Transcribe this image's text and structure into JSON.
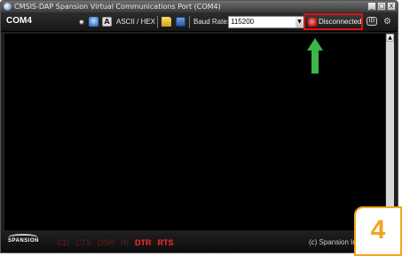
{
  "window": {
    "title": "CMSIS-DAP Spansion Virtual Communications Port (COM4)",
    "controls": {
      "minimize": "_",
      "maximize": "□",
      "close": "X"
    }
  },
  "toolbar": {
    "port": "COM4",
    "ascii_hex_label": "ASCII / HEX",
    "ascii_icon_label": "A",
    "baud_label": "Baud Rate:",
    "baud_value": "115200",
    "connection_status": "Disconnected",
    "id_icon_label": "ID"
  },
  "status_bar": {
    "logo": "SPANSION",
    "signals": [
      {
        "label": "CD",
        "active": false
      },
      {
        "label": "CTS",
        "active": false
      },
      {
        "label": "DSR",
        "active": false
      },
      {
        "label": "RI",
        "active": false
      },
      {
        "label": "DTR",
        "active": true
      },
      {
        "label": "RTS",
        "active": true
      }
    ],
    "copyright": "(c) Spansion Inc"
  },
  "annotation": {
    "step_number": "4",
    "arrow_color": "#3cb54a",
    "highlight_color": "#e01010",
    "badge_color": "#f2a51c"
  }
}
